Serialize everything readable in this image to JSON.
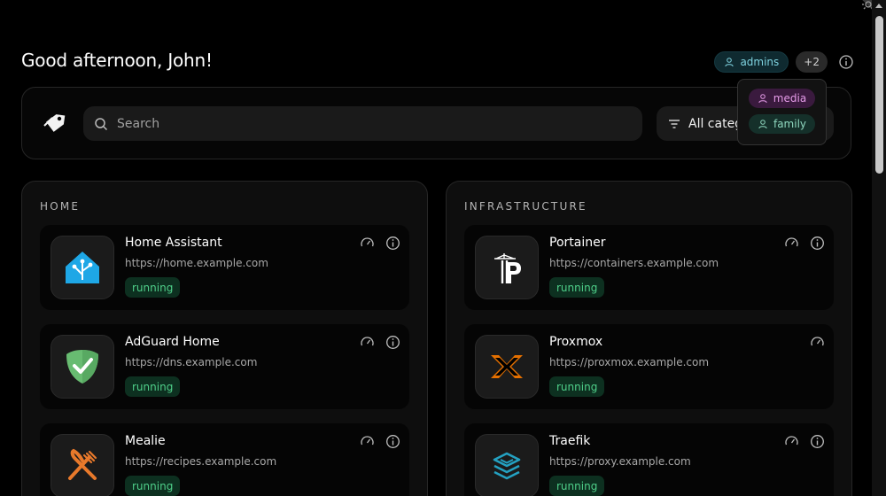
{
  "greeting": "Good afternoon, John!",
  "groups": {
    "visible": [
      {
        "label": "admins",
        "color": "#7fd3e0"
      }
    ],
    "more_count": "+2",
    "popover": [
      {
        "label": "media",
        "color": "#e59be8"
      },
      {
        "label": "family",
        "color": "#8fd8bf"
      }
    ]
  },
  "toolbar": {
    "search_placeholder": "Search",
    "category_label": "All categories"
  },
  "panels": [
    {
      "title": "HOME",
      "cards": [
        {
          "name": "Home Assistant",
          "url": "https://home.example.com",
          "status": "running",
          "icon": "home-assistant-icon",
          "actions": [
            "speedometer-icon",
            "info-icon"
          ]
        },
        {
          "name": "AdGuard Home",
          "url": "https://dns.example.com",
          "status": "running",
          "icon": "adguard-shield-icon",
          "actions": [
            "speedometer-icon",
            "info-icon"
          ]
        },
        {
          "name": "Mealie",
          "url": "https://recipes.example.com",
          "status": "running",
          "icon": "fork-knife-icon",
          "actions": [
            "speedometer-icon",
            "info-icon"
          ]
        }
      ]
    },
    {
      "title": "INFRASTRUCTURE",
      "cards": [
        {
          "name": "Portainer",
          "url": "https://containers.example.com",
          "status": "running",
          "icon": "portainer-icon",
          "actions": [
            "speedometer-icon",
            "info-icon"
          ]
        },
        {
          "name": "Proxmox",
          "url": "https://proxmox.example.com",
          "status": "running",
          "icon": "proxmox-icon",
          "actions": [
            "speedometer-icon"
          ]
        },
        {
          "name": "Traefik",
          "url": "https://proxy.example.com",
          "status": "running",
          "icon": "traefik-icon",
          "actions": [
            "speedometer-icon",
            "info-icon"
          ]
        }
      ]
    }
  ],
  "colors": {
    "background": "#000000",
    "panel": "#0e0e0e",
    "status_running_bg": "#0d3020",
    "status_running_text": "#4fd08a"
  }
}
